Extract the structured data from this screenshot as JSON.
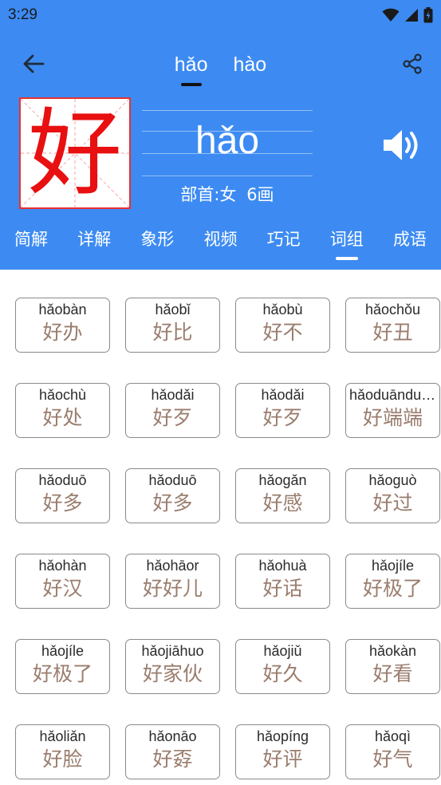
{
  "status_bar": {
    "time": "3:29"
  },
  "reading_tabs": [
    {
      "label": "hǎo",
      "selected": true
    },
    {
      "label": "hào",
      "selected": false
    }
  ],
  "character": {
    "glyph": "好",
    "pinyin": "hǎo",
    "radical_label": "部首:女",
    "strokes_label": "6画"
  },
  "section_tabs": [
    {
      "label": "简解",
      "selected": false
    },
    {
      "label": "详解",
      "selected": false
    },
    {
      "label": "象形",
      "selected": false
    },
    {
      "label": "视频",
      "selected": false
    },
    {
      "label": "巧记",
      "selected": false
    },
    {
      "label": "词组",
      "selected": true
    },
    {
      "label": "成语",
      "selected": false
    }
  ],
  "words": [
    {
      "pinyin": "hǎobàn",
      "hanzi": "好办"
    },
    {
      "pinyin": "hǎobǐ",
      "hanzi": "好比"
    },
    {
      "pinyin": "hǎobù",
      "hanzi": "好不"
    },
    {
      "pinyin": "hǎochǒu",
      "hanzi": "好丑"
    },
    {
      "pinyin": "hǎochù",
      "hanzi": "好处"
    },
    {
      "pinyin": "hǎodǎi",
      "hanzi": "好歹"
    },
    {
      "pinyin": "hǎodǎi",
      "hanzi": "好歹"
    },
    {
      "pinyin": "hǎoduānduān",
      "hanzi": "好端端"
    },
    {
      "pinyin": "hǎoduō",
      "hanzi": "好多"
    },
    {
      "pinyin": "hǎoduō",
      "hanzi": "好多"
    },
    {
      "pinyin": "hǎogǎn",
      "hanzi": "好感"
    },
    {
      "pinyin": "hǎoguò",
      "hanzi": "好过"
    },
    {
      "pinyin": "hǎohàn",
      "hanzi": "好汉"
    },
    {
      "pinyin": "hǎohāor",
      "hanzi": "好好儿"
    },
    {
      "pinyin": "hǎohuà",
      "hanzi": "好话"
    },
    {
      "pinyin": "hǎojíle",
      "hanzi": "好极了"
    },
    {
      "pinyin": "hǎojíle",
      "hanzi": "好极了"
    },
    {
      "pinyin": "hǎojiāhuo",
      "hanzi": "好家伙"
    },
    {
      "pinyin": "hǎojiǔ",
      "hanzi": "好久"
    },
    {
      "pinyin": "hǎokàn",
      "hanzi": "好看"
    },
    {
      "pinyin": "hǎoliǎn",
      "hanzi": "好脸"
    },
    {
      "pinyin": "hǎonāo",
      "hanzi": "好孬"
    },
    {
      "pinyin": "hǎopíng",
      "hanzi": "好评"
    },
    {
      "pinyin": "hǎoqì",
      "hanzi": "好气"
    }
  ],
  "colors": {
    "header_bg": "#3d8bf2",
    "character_red": "#e81010",
    "word_text": "#9a7d6e",
    "card_border": "#8a8a8a"
  },
  "icons": {
    "back": "arrow-left-icon",
    "share": "share-icon",
    "speaker": "speaker-icon",
    "wifi": "wifi-icon",
    "signal": "signal-icon",
    "battery": "battery-icon"
  }
}
